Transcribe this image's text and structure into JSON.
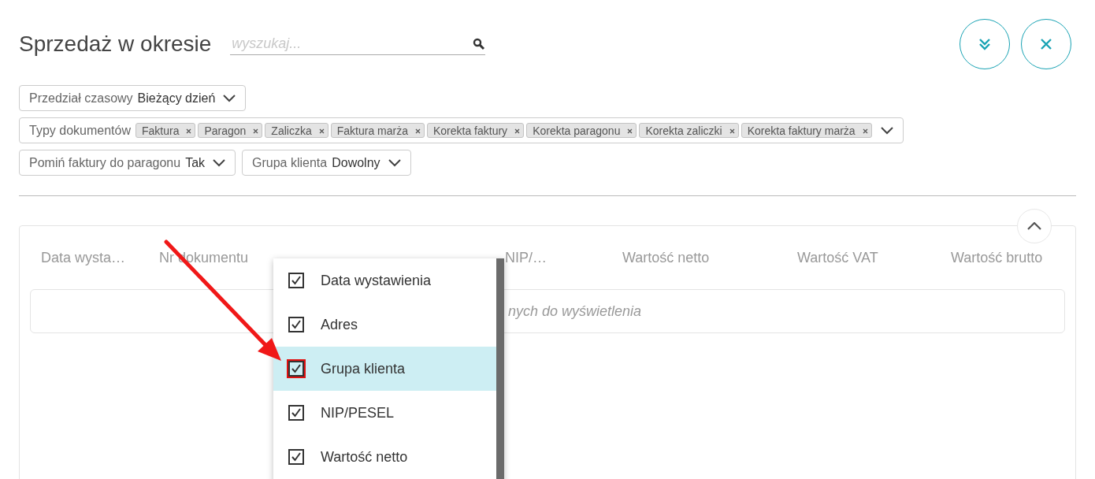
{
  "title": "Sprzedaż w okresie",
  "search": {
    "placeholder": "wyszukaj..."
  },
  "actions": [
    {
      "kind": "expand"
    },
    {
      "kind": "close"
    }
  ],
  "filter_rows": [
    [
      {
        "label": "Przedział czasowy",
        "value": "Bieżący dzień"
      }
    ],
    [
      {
        "label": "Typy dokumentów",
        "tags": [
          "Faktura",
          "Paragon",
          "Zaliczka",
          "Faktura marża",
          "Korekta faktury",
          "Korekta paragonu",
          "Korekta zaliczki",
          "Korekta faktury marża"
        ]
      }
    ],
    [
      {
        "label": "Pomiń faktury do paragonu",
        "value": "Tak"
      },
      {
        "label": "Grupa klienta",
        "value": "Dowolny"
      }
    ]
  ],
  "table": {
    "columns": [
      "Data wysta…",
      "Nr dokumentu",
      "NIP/…",
      "Wartość netto",
      "Wartość VAT",
      "Wartość brutto"
    ],
    "empty_message": "nych do wyświetlenia"
  },
  "column_menu": {
    "items": [
      {
        "label": "Data wystawienia",
        "checked": true,
        "selected": false,
        "highlighted": false
      },
      {
        "label": "Adres",
        "checked": true,
        "selected": false,
        "highlighted": false
      },
      {
        "label": "Grupa klienta",
        "checked": true,
        "selected": true,
        "highlighted": true
      },
      {
        "label": "NIP/PESEL",
        "checked": true,
        "selected": false,
        "highlighted": false
      },
      {
        "label": "Wartość netto",
        "checked": true,
        "selected": false,
        "highlighted": false
      }
    ]
  }
}
